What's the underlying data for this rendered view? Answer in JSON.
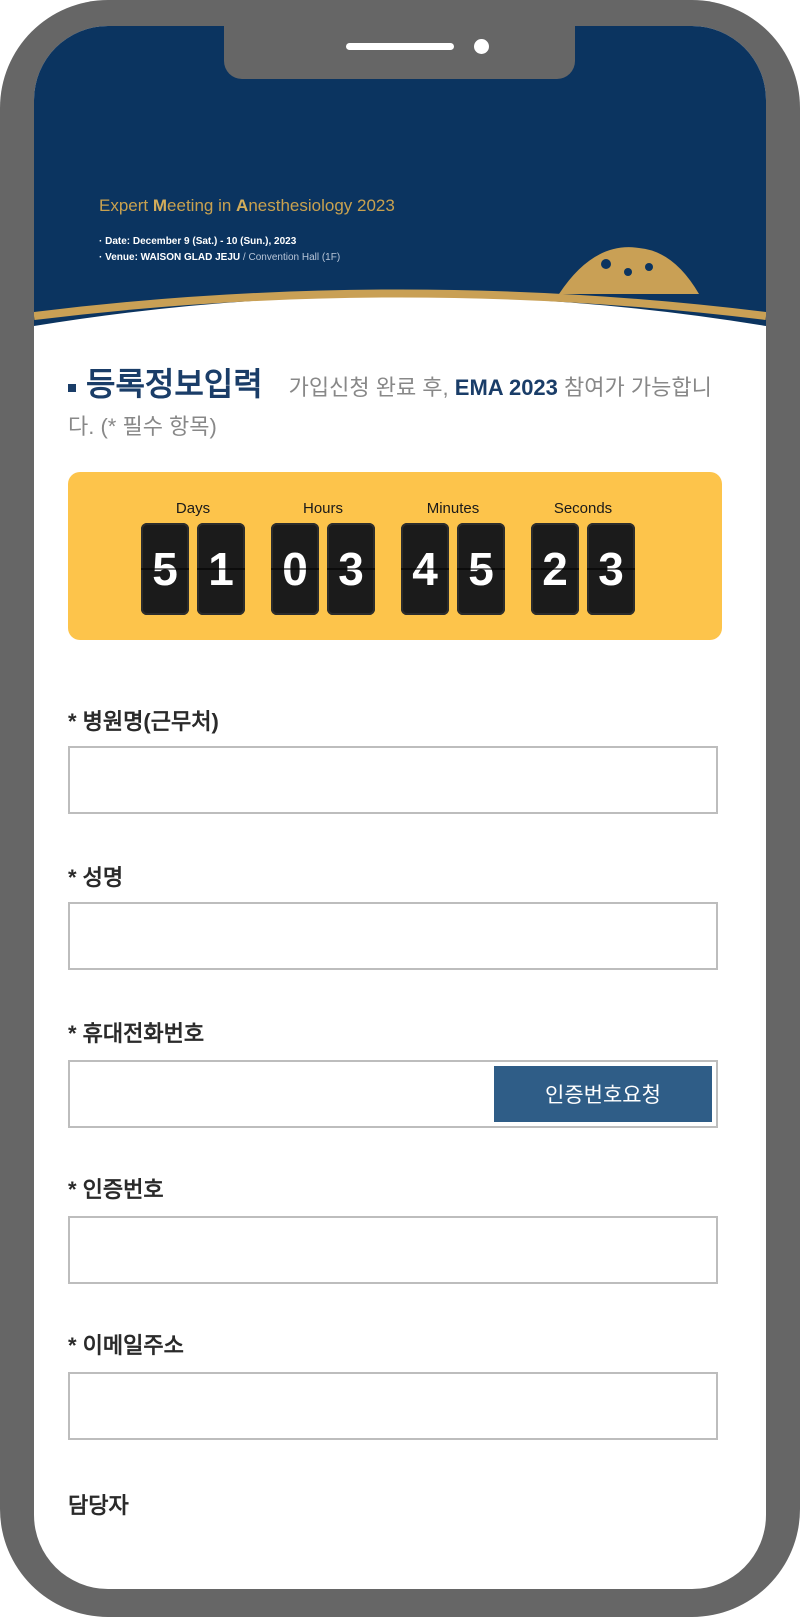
{
  "banner": {
    "title_prefix": "Expert ",
    "title_m": "M",
    "title_mid": "eeting in ",
    "title_a": "A",
    "title_rest": "nesthesiology 2023",
    "date_line": "· Date: December 9 (Sat.) - 10 (Sun.), 2023",
    "venue_label": "· Venue: WAISON GLAD JEJU",
    "venue_detail": " / Convention Hall (1F)"
  },
  "section": {
    "title": "등록정보입력",
    "desc_prefix": "가입신청 완료 후, ",
    "desc_brand": "EMA 2023",
    "desc_suffix": " 참여가 가능합니다. (* 필수 항목)"
  },
  "countdown": {
    "days_label": "Days",
    "hours_label": "Hours",
    "minutes_label": "Minutes",
    "seconds_label": "Seconds",
    "days": [
      "5",
      "1"
    ],
    "hours": [
      "0",
      "3"
    ],
    "minutes": [
      "4",
      "5"
    ],
    "seconds": [
      "2",
      "3"
    ]
  },
  "form": {
    "hospital_label": "* 병원명(근무처)",
    "hospital_value": "",
    "name_label": "* 성명",
    "name_value": "",
    "phone_label": "* 휴대전화번호",
    "phone_value": "",
    "verify_button": "인증번호요청",
    "code_label": "* 인증번호",
    "code_value": "",
    "email_label": "* 이메일주소",
    "email_value": "",
    "manager_label": "담당자"
  },
  "colors": {
    "frame": "#666666",
    "banner_bg": "#0b3460",
    "banner_gold": "#c8a14f",
    "countdown_bg": "#fdc44b",
    "verify_button_bg": "#2f5d87",
    "heading": "#1a3d68"
  }
}
